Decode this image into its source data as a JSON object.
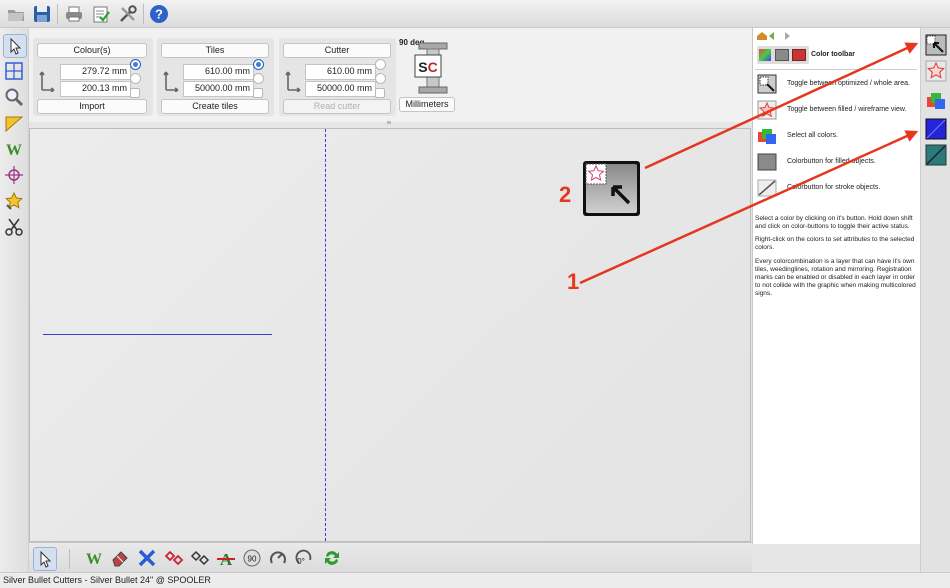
{
  "toolbar": {
    "icons": [
      "folder-open-icon",
      "save-icon",
      "printer-icon",
      "checklist-icon",
      "tools-icon",
      "help-icon"
    ]
  },
  "left_tools": [
    "select-arrow-icon",
    "tile-grid-icon",
    "magnifier-icon",
    "ruler-icon",
    "weed-w-icon",
    "crosshair-icon",
    "star-select-icon",
    "scissors-icon"
  ],
  "panels": {
    "colours": {
      "label": "Colour(s)",
      "width": "279.72 mm",
      "height": "200.13 mm",
      "button": "Import"
    },
    "tiles": {
      "label": "Tiles",
      "width": "610.00 mm",
      "height": "50000.00 mm",
      "button": "Create tiles"
    },
    "cutter": {
      "label": "Cutter",
      "width": "610.00 mm",
      "height": "50000.00 mm",
      "button": "Read cutter"
    },
    "machine": {
      "rotation": "90 deg",
      "units": "Millimeters"
    }
  },
  "right_panel": {
    "title": "Color toolbar",
    "items": [
      {
        "icon": "optimized-area-icon",
        "text": "Toggle between optimized / whole area."
      },
      {
        "icon": "filled-wireframe-icon",
        "text": "Toggle between filled / wireframe view."
      },
      {
        "icon": "all-colors-icon",
        "text": "Select all colors."
      },
      {
        "icon": "filled-color-icon",
        "text": "Colorbutton for filled objects."
      },
      {
        "icon": "stroke-color-icon",
        "text": "Colorbutton for stroke objects."
      }
    ],
    "paragraphs": [
      "Select a color by clicking on it's button. Hold down shift and click on color-buttons to toggle their active status.",
      "Right-click on the colors to set attributes to the selected colors.",
      "Every colorcombination is a layer that can have it's own tiles, weedinglines, rotation and mirroring. Registration marks can be enabled or disabled in each layer in order to not collide with the graphic when making multicolored signs."
    ]
  },
  "annotations": {
    "one": "1",
    "two": "2"
  },
  "colors": {
    "accent": "#e5371d",
    "guide": "#2424d8"
  },
  "status": "Silver Bullet Cutters - Silver Bullet 24\" @ SPOOLER"
}
